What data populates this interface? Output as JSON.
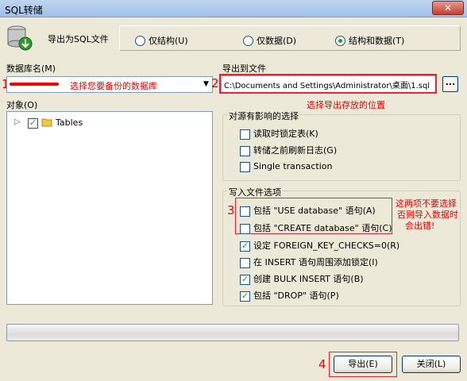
{
  "window": {
    "title": "SQL转储",
    "close": "✕"
  },
  "header": {
    "label": "导出为SQL文件"
  },
  "mode": {
    "options": [
      {
        "label": "仅结构(U)",
        "selected": false
      },
      {
        "label": "仅数据(D)",
        "selected": false
      },
      {
        "label": "结构和数据(T)",
        "selected": true
      }
    ]
  },
  "database": {
    "label": "数据库名(M)",
    "number": "1",
    "hint": "选择您要备份的数据库"
  },
  "export_file": {
    "label": "导出到文件",
    "number": "2",
    "value": "C:\\Documents and Settings\\Administrator\\桌面\\1.sql",
    "browse": "...",
    "hint": "选择导出存放的位置"
  },
  "objects": {
    "label": "对象(O)",
    "tree": [
      {
        "label": "Tables",
        "checked": true,
        "expander": "▷"
      }
    ]
  },
  "source_options": {
    "title": "对源有影响的选择",
    "items": [
      {
        "label": "读取时锁定表(K)",
        "checked": false
      },
      {
        "label": "转储之前刷新日志(G)",
        "checked": false
      },
      {
        "label": "Single transaction",
        "checked": false
      }
    ]
  },
  "file_options": {
    "title": "写入文件选项",
    "number": "3",
    "note": [
      "这两项不要选择",
      "否则导入数据时",
      "会出错!"
    ],
    "items": [
      {
        "label": "包括 \"USE database\" 语句(A)",
        "checked": false
      },
      {
        "label": "包括 \"CREATE database\" 语句(C)",
        "checked": false
      },
      {
        "label": "设定 FOREIGN_KEY_CHECKS=0(R)",
        "checked": true
      },
      {
        "label": "在 INSERT 语句周围添加锁定(I)",
        "checked": false
      },
      {
        "label": "创建 BULK INSERT 语句(B)",
        "checked": true
      },
      {
        "label": "包括 \"DROP\" 语句(P)",
        "checked": true
      }
    ]
  },
  "progress": {
    "value": 0
  },
  "buttons": {
    "number": "4",
    "export": "导出(E)",
    "close": "关闭(L)"
  },
  "colors": {
    "annotation": "#e00",
    "check": "#21a121",
    "titlebar": "#9fc0e8"
  }
}
